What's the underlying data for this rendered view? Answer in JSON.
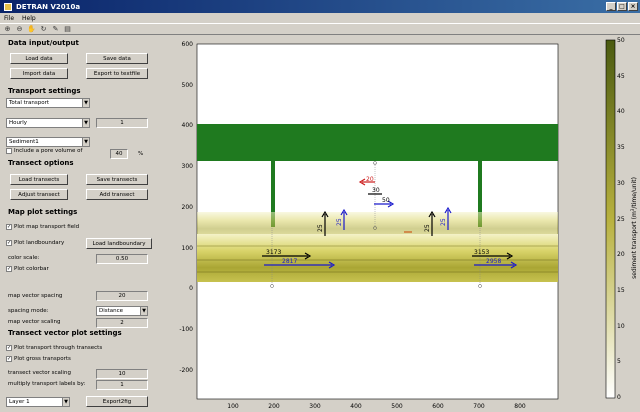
{
  "window": {
    "title": "DETRAN V2010a"
  },
  "menu": {
    "file": "File",
    "help": "Help"
  },
  "sections": {
    "data_io": "Data input/output",
    "transport_settings": "Transport settings",
    "transect_options": "Transect options",
    "map_plot": "Map plot settings",
    "transect_vector": "Transect vector plot settings"
  },
  "buttons": {
    "load_data": "Load data",
    "save_data": "Save data",
    "import_data": "Import data",
    "export_textfile": "Export to textfile",
    "load_transects": "Load transects",
    "save_transects": "Save transects",
    "adjust_transect": "Adjust transect",
    "add_transect": "Add transect",
    "load_landboundary": "Load landboundary",
    "export2fig": "Export2fig"
  },
  "transport": {
    "type_value": "Total transport",
    "period_value": "Hourly",
    "period_factor": "1",
    "sediment_value": "Sediment1",
    "pore_volume_label": "Include a pore volume of",
    "pore_volume_value": "40",
    "pore_volume_unit": "%"
  },
  "map": {
    "plot_map_field": "Plot map transport field",
    "plot_landboundary": "Plot landboundary",
    "color_scale_label": "color scale:",
    "color_scale_value": "0.50",
    "plot_colorbar": "Plot colorbar",
    "vector_spacing_label": "map vector spacing",
    "vector_spacing_value": "20",
    "spacing_mode_label": "spacing mode:",
    "spacing_mode_value": "Distance",
    "vector_scaling_label": "map vector scaling",
    "vector_scaling_value": "2"
  },
  "transect_plot": {
    "through_transects": "Plot transport through transects",
    "gross_transports": "Plot gross transports",
    "vector_scaling_label": "transect vector scaling",
    "vector_scaling_value": "10",
    "multiply_label": "multiply transport labels by:",
    "multiply_value": "1",
    "layer_value": "Layer 1"
  },
  "plot": {
    "y_ticks": [
      "600",
      "500",
      "400",
      "300",
      "200",
      "100",
      "0",
      "-100",
      "-200"
    ],
    "x_ticks": [
      "100",
      "200",
      "300",
      "400",
      "500",
      "600",
      "700",
      "800"
    ],
    "labels": [
      "20",
      "30",
      "50",
      "25",
      "25",
      "25",
      "25",
      "3173",
      "2817",
      "3153",
      "2958"
    ]
  },
  "colorbar": {
    "ticks": [
      "50",
      "45",
      "40",
      "35",
      "30",
      "25",
      "20",
      "15",
      "10",
      "5",
      "0"
    ],
    "label_prefix": "sediment transport (m",
    "label_sup": "3",
    "label_suffix": "/time/unit)"
  },
  "colors": {
    "titlebar": "#0a246a",
    "structure": "#1f7a1f",
    "sediment": "#9a9a2a",
    "vector_blue": "#1a1acc",
    "vector_red": "#cc1a1a"
  },
  "icons": [
    "zoom-in-icon",
    "zoom-out-icon",
    "pan-icon",
    "rotate-icon",
    "data-cursor-icon",
    "insert-colorbar-icon"
  ]
}
